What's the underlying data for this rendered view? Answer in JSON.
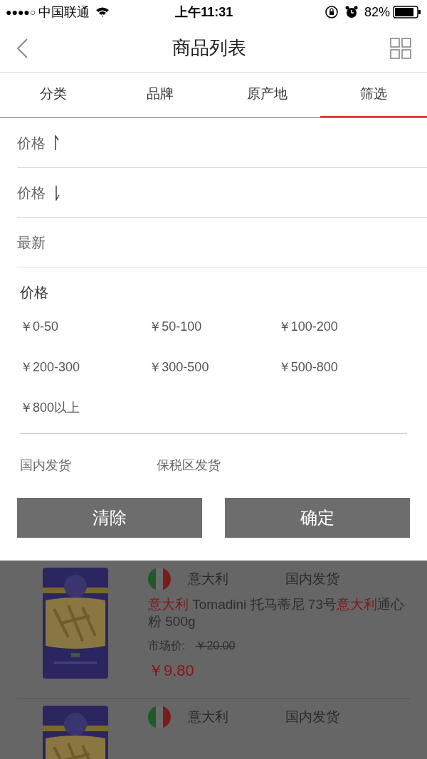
{
  "status_bar": {
    "signal": "●●●●○",
    "carrier": "中国联通",
    "time": "上午11:31",
    "battery": "82%"
  },
  "nav": {
    "title": "商品列表"
  },
  "tabs": [
    {
      "label": "分类",
      "selected": false
    },
    {
      "label": "品牌",
      "selected": false
    },
    {
      "label": "原产地",
      "selected": false
    },
    {
      "label": "筛选",
      "selected": true
    }
  ],
  "sort_options": [
    {
      "label": "价格",
      "kind": "up"
    },
    {
      "label": "价格",
      "kind": "down"
    },
    {
      "label": "最新",
      "kind": "plain"
    }
  ],
  "price_filter": {
    "title": "价格",
    "options": [
      "￥0-50",
      "￥50-100",
      "￥100-200",
      "￥200-300",
      "￥300-500",
      "￥500-800",
      "￥800以上"
    ]
  },
  "shipping_options": [
    "国内发货",
    "保税区发货"
  ],
  "buttons": [
    "清除",
    "确定"
  ],
  "products": [
    {
      "country": "意大利",
      "shipping": "国内发货",
      "title": "**意大利** Tomadini 托马蒂尼 73号**意大利**通心粉 500g",
      "market_label": "市场价:",
      "market_price": "￥20.00",
      "price": "￥9.80"
    },
    {
      "country": "意大利",
      "shipping": "国内发货"
    }
  ]
}
